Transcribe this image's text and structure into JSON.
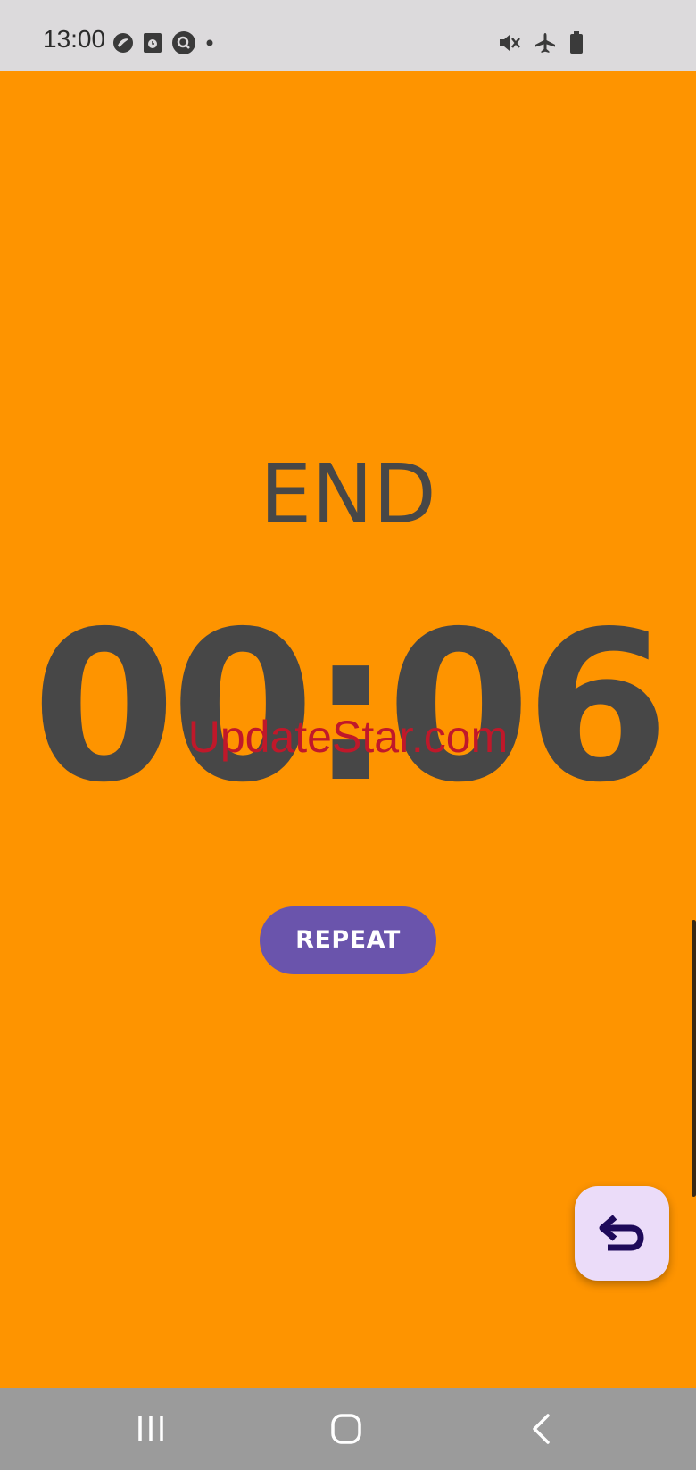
{
  "status_bar": {
    "time": "13:00",
    "left_icons": [
      "notification-app-icon",
      "clock-app-icon",
      "search-app-icon",
      "more-dot-icon"
    ],
    "right_icons": [
      "mute-icon",
      "airplane-icon",
      "battery-icon"
    ]
  },
  "timer_screen": {
    "phase_label": "END",
    "time_display": "00:06",
    "repeat_button_label": "REPEAT",
    "watermark": "UpdateStar.com"
  },
  "fab": {
    "icon": "undo-arrow-icon"
  },
  "nav_bar": {
    "buttons": [
      "recent-apps-icon",
      "home-icon",
      "back-icon"
    ]
  },
  "colors": {
    "background": "#fe9400",
    "text": "#474747",
    "button": "#6a54ac",
    "fab": "#ebdcf9",
    "watermark": "#c0182a"
  }
}
